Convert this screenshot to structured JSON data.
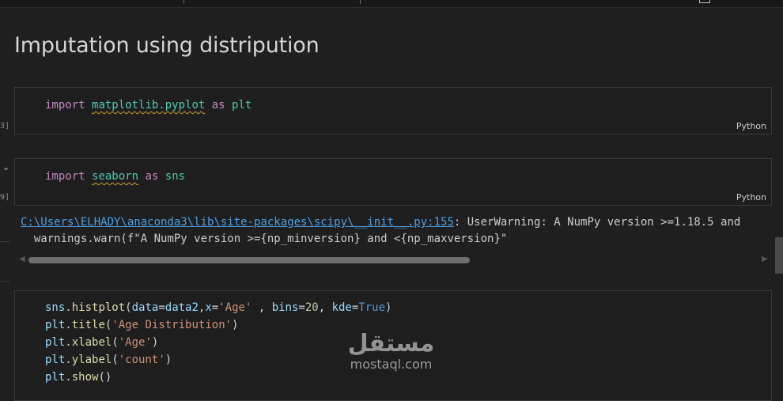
{
  "heading": "Imputation using distripution",
  "cells": [
    {
      "exec_count": "3]",
      "language": "Python"
    },
    {
      "exec_count": "9]",
      "language": "Python"
    }
  ],
  "code": {
    "import_kw": "import",
    "as_kw": "as",
    "cell1_module": "matplotlib.pyplot",
    "cell1_alias": "plt",
    "cell2_module": "seaborn",
    "cell2_alias": "sns"
  },
  "output": {
    "path_link": "C:\\Users\\ELHADY\\anaconda3\\lib\\site-packages\\scipy\\__init__.py:155",
    "warning_text": ": UserWarning: A NumPy version >=1.18.5 and",
    "line2": "  warnings.warn(f\"A NumPy version >={np_minversion} and <{np_maxversion}\""
  },
  "cell3": {
    "l1_obj": "sns",
    "l1_fn": "histplot",
    "l1_p_data": "data",
    "l1_data_val": "data2",
    "l1_p_x": "x",
    "l1_x_val": "'Age'",
    "l1_p_bins": "bins",
    "l1_bins_val": "20",
    "l1_p_kde": "kde",
    "l1_kde_val": "True",
    "l2_obj": "plt",
    "l2_fn": "title",
    "l2_arg": "'Age Distribution'",
    "l3_obj": "plt",
    "l3_fn": "xlabel",
    "l3_arg": "'Age'",
    "l4_obj": "plt",
    "l4_fn": "ylabel",
    "l4_arg": "'count'",
    "l5_obj": "plt",
    "l5_fn": "show"
  },
  "watermark": {
    "arabic": "مستقل",
    "latin": "mostaql.com"
  },
  "icons": {
    "collapse": "chevron-down-icon",
    "scroll_left": "scroll-left-arrow-icon",
    "scroll_right": "scroll-right-arrow-icon"
  }
}
